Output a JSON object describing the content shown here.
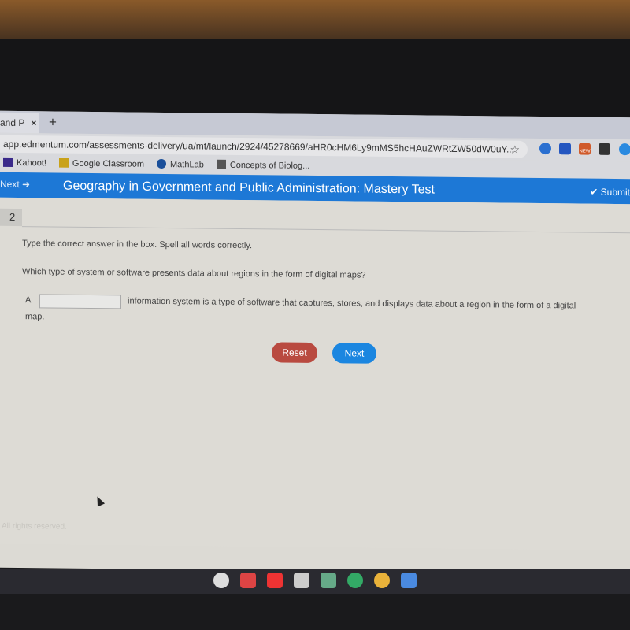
{
  "browser": {
    "tab_title": "and P",
    "tab_close": "×",
    "new_tab": "+",
    "url": "app.edmentum.com/assessments-delivery/ua/mt/launch/2924/45278669/aHR0cHM6Ly9mMS5hcHAuZWRtZW50dW0uY...",
    "star_icon": "☆",
    "bookmarks": [
      {
        "label": "Kahoot!",
        "color": "#3b2a8a"
      },
      {
        "label": "Google Classroom",
        "color": "#c9a21a"
      },
      {
        "label": "MathLab",
        "color": "#1a4f9a"
      },
      {
        "label": "Concepts of Biolog...",
        "color": "#555555"
      }
    ],
    "extension_badge": "NEW"
  },
  "header": {
    "next_label": "Next",
    "title": "Geography in Government and Public Administration: Mastery Test",
    "submit_label": "Submit",
    "accent": "#1d78d6"
  },
  "question": {
    "number": "2",
    "instruction": "Type the correct answer in the box. Spell all words correctly.",
    "prompt": "Which type of system or software presents data about regions in the form of digital maps?",
    "sentence_start": "A",
    "sentence_end": "information system is a type of software that captures, stores, and displays data about a region in the form of a digital",
    "sentence_wrap": "map.",
    "answer_value": ""
  },
  "buttons": {
    "reset": "Reset",
    "next": "Next",
    "reset_color": "#b94a40",
    "next_color": "#1b86e0"
  },
  "footer": "All rights reserved."
}
